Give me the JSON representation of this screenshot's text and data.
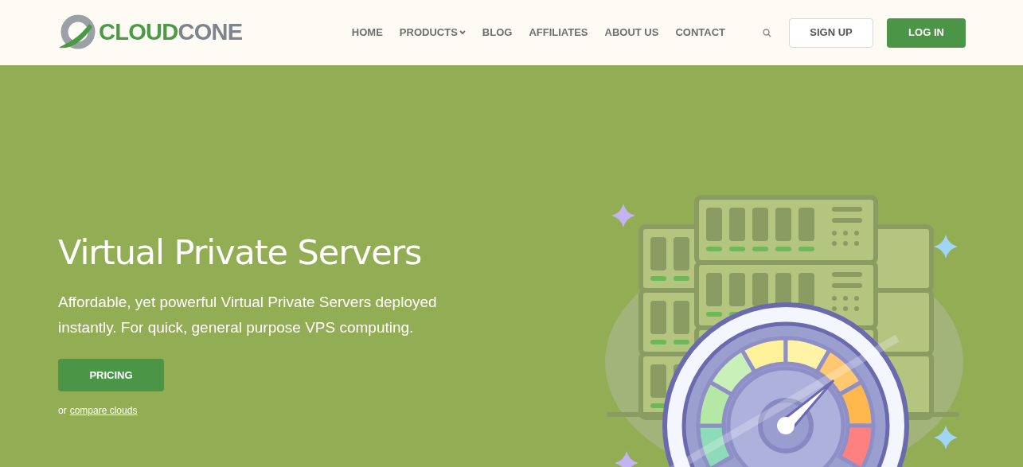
{
  "header": {
    "logo": {
      "part_1": "CLOUD",
      "part_2": "CONE"
    },
    "nav": [
      {
        "label": "HOME",
        "has_menu": false
      },
      {
        "label": "PRODUCTS",
        "has_menu": true
      },
      {
        "label": "BLOG",
        "has_menu": false
      },
      {
        "label": "AFFILIATES",
        "has_menu": false
      },
      {
        "label": "ABOUT US",
        "has_menu": false
      },
      {
        "label": "CONTACT",
        "has_menu": false
      }
    ],
    "signup": "SIGN UP",
    "login": "LOG IN"
  },
  "hero": {
    "title": "Virtual Private Servers",
    "subtitle": "Affordable, yet powerful Virtual Private Servers deployed instantly. For quick, general purpose VPS computing.",
    "button": "PRICING",
    "alt_prefix": "or",
    "alt_link": "compare clouds"
  }
}
